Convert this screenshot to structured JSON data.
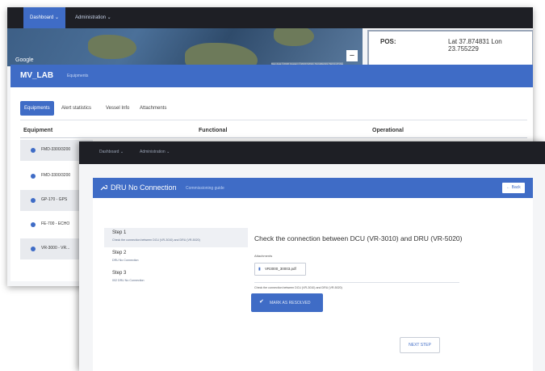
{
  "back_window": {
    "nav": {
      "dashboard": "Dashboard ⌄",
      "administration": "Administration ⌄"
    },
    "map": {
      "google_logo": "Google",
      "zoom_out": "−",
      "attribution": "Map data ©2020 Imagery ©2020 NASA, TerraMetrics  Terms of Use"
    },
    "position": {
      "label": "POS:",
      "value": "Lat 37.874831 Lon 23.755229"
    },
    "header": {
      "title": "MV_LAB",
      "subtitle": "Equipments"
    },
    "tabs": [
      "Equipments",
      "Alert statistics",
      "Vessel Info",
      "Attachments"
    ],
    "columns": [
      "Equipment",
      "Functional",
      "Operational"
    ],
    "equipment_rows": [
      "FMD-3300/3200",
      "FMD-3300/3200",
      "GP-170 - GPS",
      "FE-700 - ECHO",
      "VR-3000 - VR..."
    ]
  },
  "front_window": {
    "nav": {
      "dashboard": "Dashboard ⌄",
      "administration": "Administration ⌄"
    },
    "header": {
      "title": "DRU No Connection",
      "subtitle": "Commissioning guide",
      "back_label": "← Back"
    },
    "steps": [
      {
        "title": "Step 1",
        "desc": "Check the connection between DCU (VR-3010) and DRU (VR-5020)"
      },
      {
        "title": "Step 2",
        "desc": "DRU No Connection"
      },
      {
        "title": "Step 3",
        "desc": "002 DRU No Connection"
      }
    ],
    "content": {
      "title": "Check the connection between DCU (VR-3010) and DRU (VR-5020)",
      "attachments_label": "Attachments",
      "file_name": "VR3000_30003.pdf",
      "note": "Check the connection between DCU (VR-3010) and DRU (VR-5020)",
      "resolve_label": "MARK AS RESOLVED",
      "next_label": "NEXT STEP"
    }
  },
  "colors": {
    "accent": "#3f6cc6",
    "topbar": "#1e1f25",
    "panel_bg": "#f4f5f7"
  }
}
